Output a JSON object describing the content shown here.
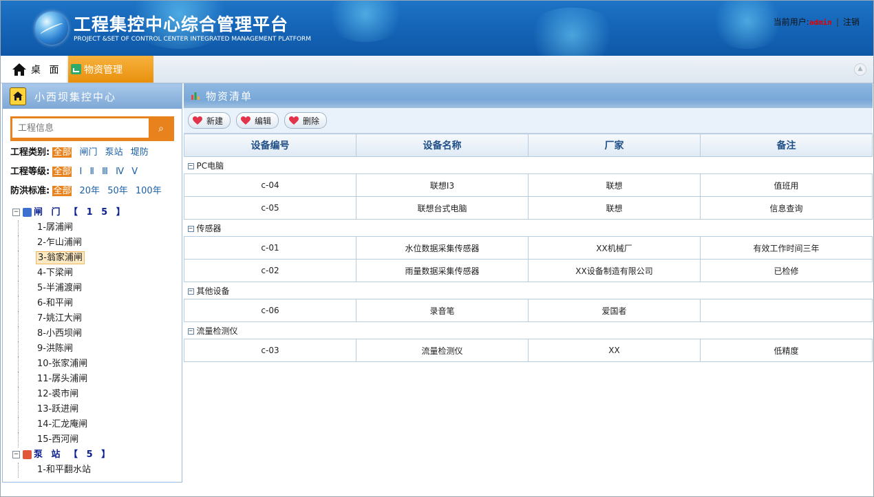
{
  "header": {
    "title_cn": "工程集控中心综合管理平台",
    "title_en": "PROJECT &SET OF CONTROL CENTER INTEGRATED MANAGEMENT PLATFORM",
    "current_user_label": "当前用户:",
    "username": "admin",
    "logout_label": "注销"
  },
  "tabs": {
    "desktop": "桌 面",
    "material": "物资管理"
  },
  "left": {
    "title": "小西坝集控中心",
    "search_placeholder": "工程信息",
    "filters": [
      {
        "label": "工程类别:",
        "options": [
          "全部",
          "闸门",
          "泵站",
          "堤防"
        ],
        "selected": "全部"
      },
      {
        "label": "工程等级:",
        "options": [
          "全部",
          "Ⅰ",
          "Ⅱ",
          "Ⅲ",
          "Ⅳ",
          "Ⅴ"
        ],
        "selected": "全部"
      },
      {
        "label": "防洪标准:",
        "options": [
          "全部",
          "20年",
          "50年",
          "100年"
        ],
        "selected": "全部"
      }
    ],
    "tree": {
      "group1": "闸 门 【 1 5 】",
      "gates": [
        "1-孱浦闸",
        "2-乍山浦闸",
        "3-翁家浦闸",
        "4-下梁闸",
        "5-半浦渡闸",
        "6-和平闸",
        "7-姚江大闸",
        "8-小西坝闸",
        "9-洪陈闸",
        "10-张家浦闸",
        "11-孱头浦闸",
        "12-裘市闸",
        "13-跃进闸",
        "14-汇龙庵闸",
        "15-西河闸"
      ],
      "selected_gate": "3-翁家浦闸",
      "group2": "泵 站 【 5 】",
      "stations": [
        "1-和平翻水站"
      ]
    }
  },
  "right": {
    "title": "物资清单",
    "toolbar": {
      "new": "新建",
      "edit": "编辑",
      "delete": "删除"
    },
    "columns": [
      "设备编号",
      "设备名称",
      "厂家",
      "备注"
    ],
    "groups": [
      {
        "name": "PC电脑",
        "rows": [
          [
            "c-04",
            "联想I3",
            "联想",
            "值班用"
          ],
          [
            "c-05",
            "联想台式电脑",
            "联想",
            "信息查询"
          ]
        ]
      },
      {
        "name": "传感器",
        "rows": [
          [
            "c-01",
            "水位数据采集传感器",
            "XX机械厂",
            "有效工作时间三年"
          ],
          [
            "c-02",
            "雨量数据采集传感器",
            "XX设备制造有限公司",
            "已检修"
          ]
        ]
      },
      {
        "name": "其他设备",
        "rows": [
          [
            "c-06",
            "录音笔",
            "爱国者",
            ""
          ]
        ]
      },
      {
        "name": "流量检测仪",
        "rows": [
          [
            "c-03",
            "流量检测仪",
            "XX",
            "低精度"
          ]
        ]
      }
    ]
  }
}
